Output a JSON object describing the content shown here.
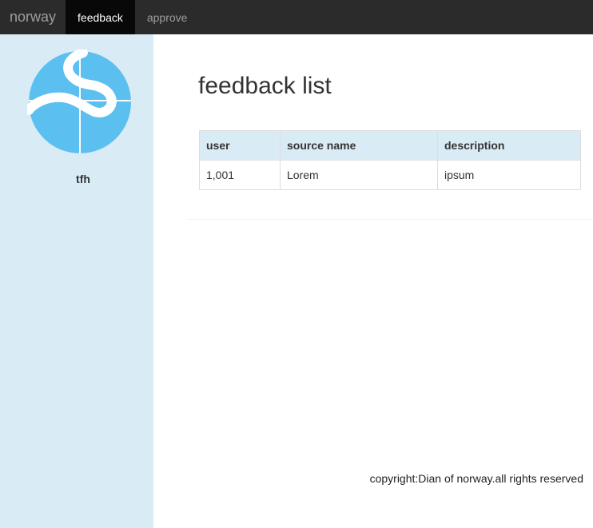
{
  "navbar": {
    "brand": "norway",
    "links": [
      {
        "label": "feedback",
        "active": true
      },
      {
        "label": "approve",
        "active": false
      }
    ]
  },
  "sidebar": {
    "username": "tfh",
    "logo_color": "#5bc0f0"
  },
  "main": {
    "title": "feedback list",
    "table": {
      "headers": [
        "user",
        "source name",
        "description"
      ],
      "rows": [
        [
          "1,001",
          "Lorem",
          "ipsum"
        ]
      ]
    }
  },
  "footer": {
    "text": "copyright:Dian of norway.all rights reserved"
  },
  "colors": {
    "navbar_bg": "#2b2b2b",
    "nav_active_bg": "#080808",
    "sidebar_bg": "#d9ecf6",
    "table_header_bg": "#d9ecf6"
  }
}
